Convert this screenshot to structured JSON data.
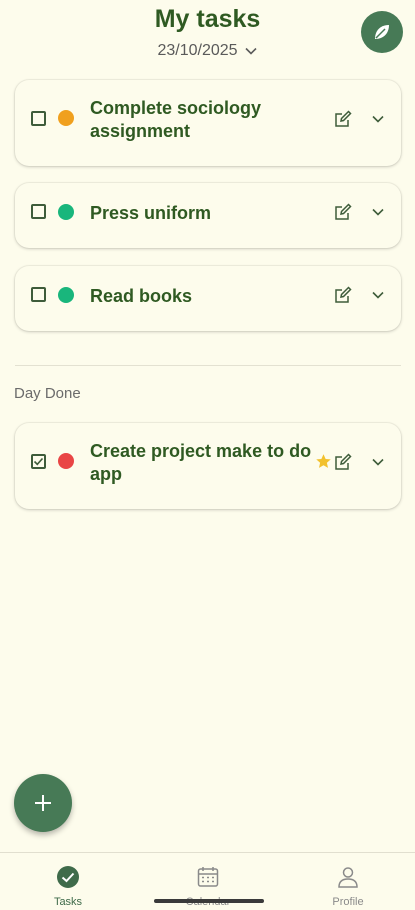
{
  "header": {
    "title": "My tasks",
    "date": "23/10/2025",
    "profile_icon": "leaf-icon"
  },
  "tasks": [
    {
      "text": "Complete sociology assignment",
      "checked": false,
      "priority_color": "#f0a01e",
      "starred": false
    },
    {
      "text": "Press uniform",
      "checked": false,
      "priority_color": "#19b67c",
      "starred": false
    },
    {
      "text": "Read books",
      "checked": false,
      "priority_color": "#19b67c",
      "starred": false
    }
  ],
  "done_section": {
    "label": "Day Done",
    "tasks": [
      {
        "text": "Create project make to do app",
        "checked": true,
        "priority_color": "#e94545",
        "starred": true
      }
    ]
  },
  "fab": {
    "icon": "plus-icon"
  },
  "bottom_nav": {
    "items": [
      {
        "label": "Tasks",
        "icon": "check-circle-icon",
        "active": true
      },
      {
        "label": "Calendar",
        "icon": "calendar-icon",
        "active": false
      },
      {
        "label": "Profile",
        "icon": "person-icon",
        "active": false
      }
    ]
  },
  "colors": {
    "background": "#fdfcec",
    "accent": "#477a56",
    "text": "#2f5a22"
  }
}
